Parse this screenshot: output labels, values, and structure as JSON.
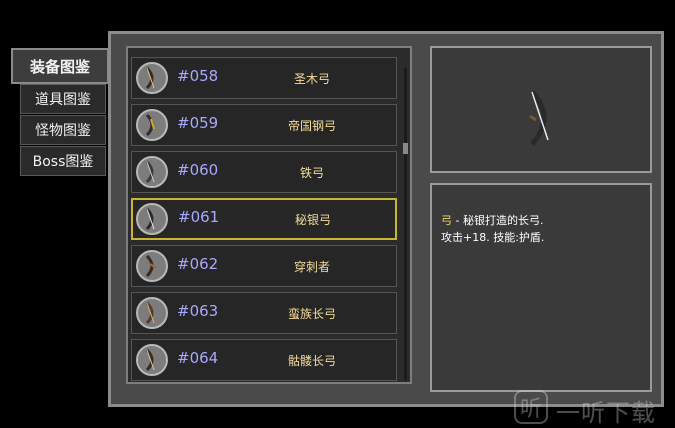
{
  "tabs": [
    {
      "label": "装备图鉴",
      "active": true
    },
    {
      "label": "道具图鉴",
      "active": false
    },
    {
      "label": "怪物图鉴",
      "active": false
    },
    {
      "label": "Boss图鉴",
      "active": false
    }
  ],
  "items": [
    {
      "number": "#058",
      "name": "圣木弓",
      "icon": "bow-icon"
    },
    {
      "number": "#059",
      "name": "帝国钢弓",
      "icon": "bow-icon"
    },
    {
      "number": "#060",
      "name": "铁弓",
      "icon": "bow-icon"
    },
    {
      "number": "#061",
      "name": "秘银弓",
      "icon": "bow-icon",
      "selected": true
    },
    {
      "number": "#062",
      "name": "穿刺者",
      "icon": "bow-icon"
    },
    {
      "number": "#063",
      "name": "蛮族长弓",
      "icon": "bow-icon"
    },
    {
      "number": "#064",
      "name": "骷髅长弓",
      "icon": "bow-icon"
    }
  ],
  "detail": {
    "type_keyword": "弓",
    "line1_rest": " - 秘银打造的长弓.",
    "line2": "攻击+18. 技能:护盾."
  },
  "watermark": {
    "logo": "听",
    "text": "一听下载"
  },
  "colors": {
    "selected_border": "#c9b636",
    "item_number": "#a8a8ff",
    "item_name": "#f4dc9a"
  }
}
